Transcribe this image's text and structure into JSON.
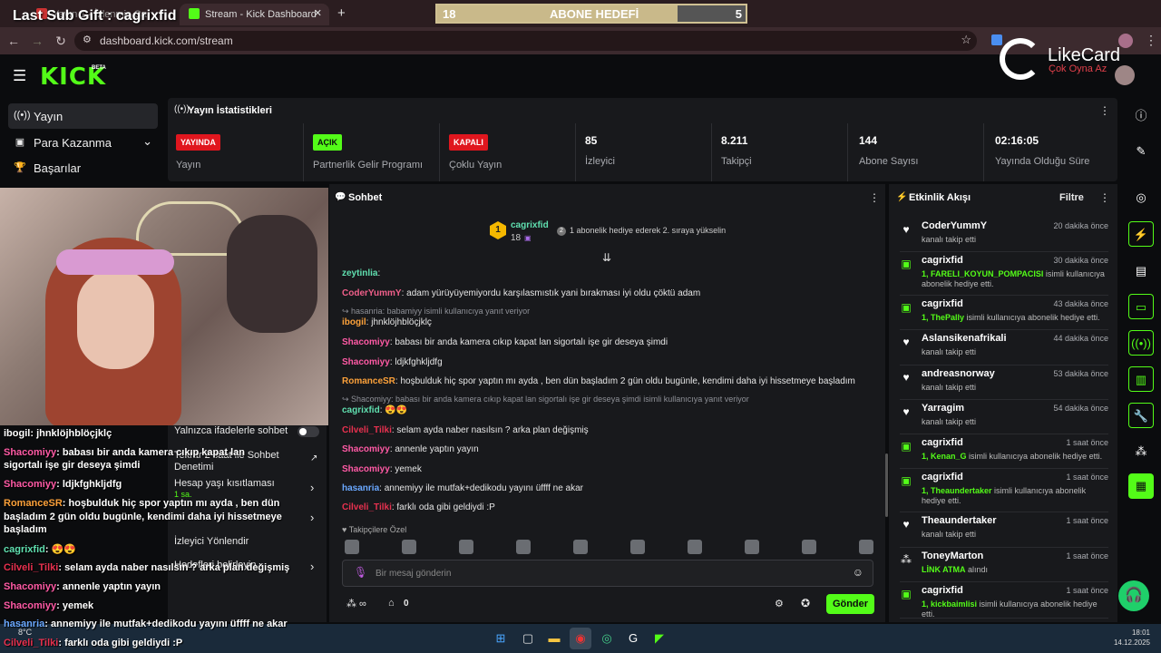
{
  "browser": {
    "tabs": [
      {
        "label": "Yayın 1 - İzlenmiş Ca"
      },
      {
        "label": "Stream - Kick Dashboard"
      }
    ],
    "url": "dashboard.kick.com/stream",
    "new_tab": "+"
  },
  "overlay": {
    "last_sub_gift": "Last Sub Gift : cagrixfid",
    "goal": {
      "left": "18",
      "title": "ABONE HEDEFİ",
      "right": "5",
      "progress": 0.78
    },
    "likecard": {
      "brand": "LikeCard",
      "tagline": "Çok Oyna  Az"
    }
  },
  "kick": {
    "logo": "KICK",
    "beta": "BETA",
    "sidebar": [
      {
        "label": "Yayın",
        "icon": "broadcast-icon"
      },
      {
        "label": "Para Kazanma",
        "icon": "money-icon"
      },
      {
        "label": "Başarılar",
        "icon": "trophy-icon"
      }
    ],
    "stats": {
      "title": "Yayın İstatistikleri",
      "items": [
        {
          "badge": "YAYINDA",
          "badge_color": "#e0161e",
          "label": "Yayın"
        },
        {
          "badge": "AÇIK",
          "badge_color": "#53fc18",
          "label": "Partnerlik Gelir Programı"
        },
        {
          "badge": "KAPALI",
          "badge_color": "#e0161e",
          "label": "Çoklu Yayın"
        },
        {
          "value": "85",
          "label": "İzleyici"
        },
        {
          "value": "8.211",
          "label": "Takipçi"
        },
        {
          "value": "144",
          "label": "Abone Sayısı"
        },
        {
          "value": "02:16:05",
          "label": "Yayında Olduğu Süre"
        }
      ]
    },
    "chat": {
      "title": "Sohbet",
      "pinned_user": "cagrixfid",
      "pinned_count": "18",
      "pinned_rank": "2",
      "pinned_text": "1 abonelik hediye ederek 2. sıraya yükselin",
      "messages": [
        {
          "user": "zeytinlia",
          "text": "",
          "color": "#60e0b0"
        },
        {
          "user": "CoderYummY",
          "text": "adam yürüyüyemiyordu karşılasmıstık yani bırakması iyi oldu çöktü adam",
          "color": "#f05f8a"
        },
        {
          "reply": "hasanria: babamiyy isimli kullanıcıya yanıt veriyor"
        },
        {
          "user": "ibogil",
          "text": "jhnklöjhblöçjklç",
          "color": "#fca13a"
        },
        {
          "user": "Shacomiyy",
          "text": "babası bir anda kamera cıkıp kapat lan sigortalı işe gir deseya şimdi",
          "color": "#ff5aa5"
        },
        {
          "user": "Shacomiyy",
          "text": "ldjkfghkljdfg",
          "color": "#ff5aa5"
        },
        {
          "user": "RomanceSR",
          "text": "hoşbulduk hiç spor yaptın mı ayda , ben dün başladım 2 gün oldu bugünle, kendimi daha iyi hissetmeye başladım",
          "color": "#fca13a"
        },
        {
          "reply": "Shacomiyy: babası bir anda kamera cıkıp kapat lan sigortalı işe gir deseya şimdi isimli kullanıcıya yanıt veriyor"
        },
        {
          "user": "cagrixfid",
          "text": "😍😍",
          "color": "#60e0b0"
        },
        {
          "user": "Cilveli_Tilki",
          "text": "selam ayda naber nasılsın ? arka plan değişmiş",
          "color": "#e8314f"
        },
        {
          "user": "Shacomiyy",
          "text": "annenle yaptın yayın",
          "color": "#ff5aa5"
        },
        {
          "user": "Shacomiyy",
          "text": "yemek",
          "color": "#ff5aa5"
        },
        {
          "user": "hasanria",
          "text": "annemiyy ile mutfak+dedikodu yayını üffff ne akar",
          "color": "#6aa8ff"
        },
        {
          "user": "Cilveli_Tilki",
          "text": "farklı oda gibi geldiydi :P",
          "color": "#e8314f"
        }
      ],
      "followers_only": "Takipçilere Özel",
      "input_placeholder": "Bir mesaj gönderin",
      "points": "0",
      "send": "Gönder"
    },
    "activity": {
      "title": "Etkinlik Akışı",
      "filter": "Filtre",
      "events": [
        {
          "name": "CoderYummY",
          "time": "20 dakika önce",
          "desc": "kanalı takip etti",
          "type": "follow"
        },
        {
          "name": "cagrixfid",
          "time": "30 dakika önce",
          "highlight": "1, FARELI_KOYUN_POMPACISI",
          "desc": " isimli kullanıcıya abonelik hediye etti.",
          "type": "gift"
        },
        {
          "name": "cagrixfid",
          "time": "43 dakika önce",
          "highlight": "1, ThePally",
          "desc": " isimli kullanıcıya abonelik hediye etti.",
          "type": "gift"
        },
        {
          "name": "Aslansikenafrikali",
          "time": "44 dakika önce",
          "desc": "kanalı takip etti",
          "type": "follow"
        },
        {
          "name": "andreasnorway",
          "time": "53 dakika önce",
          "desc": "kanalı takip etti",
          "type": "follow"
        },
        {
          "name": "Yarragim",
          "time": "54 dakika önce",
          "desc": "kanalı takip etti",
          "type": "follow"
        },
        {
          "name": "cagrixfid",
          "time": "1 saat önce",
          "highlight": "1, Kenan_G",
          "desc": " isimli kullanıcıya abonelik hediye etti.",
          "type": "gift"
        },
        {
          "name": "cagrixfid",
          "time": "1 saat önce",
          "highlight": "1, Theaundertaker",
          "desc": " isimli kullanıcıya abonelik hediye etti.",
          "type": "gift"
        },
        {
          "name": "Theaundertaker",
          "time": "1 saat önce",
          "desc": "kanalı takip etti",
          "type": "follow"
        },
        {
          "name": "ToneyMarton",
          "time": "1 saat önce",
          "highlight": "LİNK ATMA",
          "desc": " alındı",
          "type": "reward"
        },
        {
          "name": "cagrixfid",
          "time": "1 saat önce",
          "highlight": "1, kickbaimlisi",
          "desc": " isimli kullanıcıya abonelik hediye etti.",
          "type": "gift"
        }
      ]
    },
    "settings": {
      "emote_only": "Yalnızca ifadelerle sohbet",
      "replay": "Tekrar 2 saat ile Sohbet Denetimi",
      "age": "Hesap yaşı kısıtlaması",
      "age_value": "1 sa.",
      "redirect": "İzleyici Yönlendir",
      "goals": "Hedefleri belirleyin"
    }
  },
  "overlay_chat": [
    {
      "user": "ibogil",
      "text": "jhnklöjhblöçjklç",
      "color": "#fff"
    },
    {
      "user": "Shacomiyy",
      "text": "babası bir anda kamera cıkıp kapat lan",
      "color": "#ff5aa5"
    },
    {
      "user": "",
      "text": "sigortalı işe gir deseya şimdi",
      "color": "#fff"
    },
    {
      "user": "Shacomiyy",
      "text": "ldjkfghkljdfg",
      "color": "#ff5aa5"
    },
    {
      "user": "RomanceSR",
      "text": "hoşbulduk hiç spor yaptın mı ayda , ben dün",
      "color": "#fca13a"
    },
    {
      "user": "",
      "text": "başladım 2 gün oldu bugünle, kendimi daha iyi hissetmeye",
      "color": "#fff"
    },
    {
      "user": "",
      "text": "başladım",
      "color": "#fff"
    },
    {
      "user": "cagrixfid",
      "text": "😍😍",
      "color": "#60e0b0"
    },
    {
      "user": "Cilveli_Tilki",
      "text": "selam ayda naber nasılsın ? arka plan değişmiş",
      "color": "#e8314f"
    },
    {
      "user": "Shacomiyy",
      "text": "annenle yaptın yayın",
      "color": "#ff5aa5"
    },
    {
      "user": "Shacomiyy",
      "text": "yemek",
      "color": "#ff5aa5"
    },
    {
      "user": "hasanria",
      "text": "annemiyy ile mutfak+dedikodu yayını üffff ne akar",
      "color": "#6aa8ff"
    },
    {
      "user": "Cilveli_Tilki",
      "text": "farklı oda gibi geldiydi :P",
      "color": "#e8314f"
    }
  ],
  "taskbar": {
    "weather": "8°C",
    "time": "18:01",
    "date": "14.12.2025"
  }
}
